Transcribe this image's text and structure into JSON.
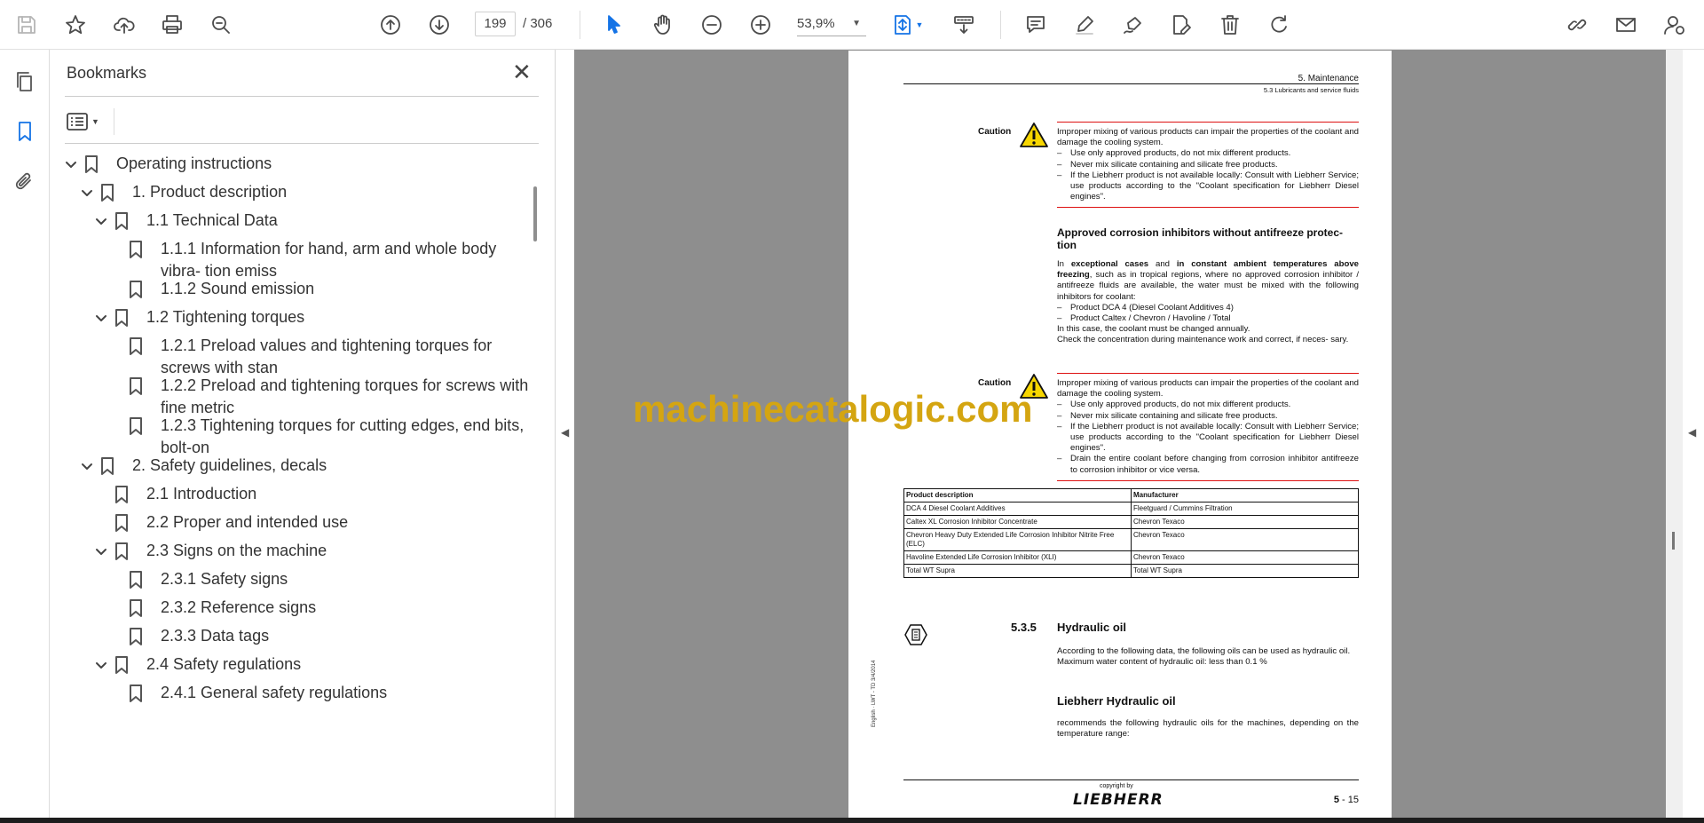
{
  "toolbar": {
    "page_current": "199",
    "page_total": "/ 306",
    "zoom": "53,9%",
    "accent_color": "#1473e6"
  },
  "panel": {
    "title": "Bookmarks",
    "close": "✕"
  },
  "bookmarks": [
    {
      "label": "Operating instructions",
      "level": 0,
      "expanded": true
    },
    {
      "label": "1. Product description",
      "level": 1,
      "expanded": true
    },
    {
      "label": "1.1 Technical Data",
      "level": 2,
      "expanded": true
    },
    {
      "label": "1.1.1 Information for hand, arm and whole body vibra- tion emiss",
      "level": 3
    },
    {
      "label": "1.1.2 Sound emission",
      "level": 3
    },
    {
      "label": "1.2 Tightening torques",
      "level": 2,
      "expanded": true
    },
    {
      "label": "1.2.1 Preload values and tightening torques for screws with stan",
      "level": 3
    },
    {
      "label": "1.2.2 Preload and tightening torques for screws with fine metric",
      "level": 3
    },
    {
      "label": "1.2.3 Tightening torques for cutting edges, end bits, bolt-on",
      "level": 3
    },
    {
      "label": "2. Safety guidelines, decals",
      "level": 1,
      "expanded": true
    },
    {
      "label": "2.1 Introduction",
      "level": 2
    },
    {
      "label": "2.2 Proper and intended use",
      "level": 2
    },
    {
      "label": "2.3 Signs on the machine",
      "level": 2,
      "expanded": true
    },
    {
      "label": "2.3.1 Safety signs",
      "level": 3
    },
    {
      "label": "2.3.2 Reference signs",
      "level": 3
    },
    {
      "label": "2.3.3 Data tags",
      "level": 3
    },
    {
      "label": "2.4 Safety regulations",
      "level": 2,
      "expanded": true
    },
    {
      "label": "2.4.1 General safety regulations",
      "level": 3
    }
  ],
  "doc": {
    "header_chapter": "5. Maintenance",
    "header_section": "5.3 Lubricants and service fluids",
    "caution_label": "Caution",
    "caution1_intro": "Improper mixing of various products can impair the properties of the coolant and damage the cooling system.",
    "caution1_items": [
      "Use only approved products, do not mix different products.",
      "Never mix silicate containing and silicate free products.",
      "If the Liebherr product is not available locally: Consult with Liebherr Service; use products according to the \"Coolant specification for Liebherr Diesel engines\"."
    ],
    "inhib_heading": "Approved corrosion inhibitors without antifreeze protec- tion",
    "inhib_p1_a": "In ",
    "inhib_p1_b": "exceptional cases",
    "inhib_p1_c": " and ",
    "inhib_p1_d": "in constant ambient temperatures above freezing",
    "inhib_p1_e": ", such as in tropical regions, where no approved corrosion inhibitor / antifreeze fluids are available, the water must be mixed with the following inhibitors for coolant:",
    "inhib_items": [
      "Product DCA 4 (Diesel Coolant Additives 4)",
      "Product Caltex / Chevron / Havoline / Total"
    ],
    "inhib_p2": "In this case, the coolant must be changed annually.",
    "inhib_p3": "Check the concentration during maintenance work and correct, if neces- sary.",
    "caution2_intro": "Improper mixing of various products can impair the properties of the coolant and damage the cooling system.",
    "caution2_items": [
      "Use only approved products, do not mix different products.",
      "Never mix silicate containing and silicate free products.",
      "If the Liebherr product is not available locally: Consult with Liebherr Service; use products according to the \"Coolant specification for Liebherr Diesel engines\".",
      "Drain the entire coolant before changing from corrosion inhibitor antifreeze to corrosion inhibitor or vice versa."
    ],
    "table_headers": [
      "Product description",
      "Manufacturer"
    ],
    "table_rows": [
      [
        "DCA 4 Diesel Coolant Additives",
        "Fleetguard / Cummins Filtration"
      ],
      [
        "Caltex XL Corrosion Inhibitor Concentrate",
        "Chevron Texaco"
      ],
      [
        "Chevron Heavy Duty Extended Life Corrosion Inhibitor Nitrite Free (ELC)",
        "Chevron Texaco"
      ],
      [
        "Havoline Extended Life Corrosion Inhibitor (XLI)",
        "Chevron Texaco"
      ],
      [
        "Total WT Supra",
        "Total WT Supra"
      ]
    ],
    "sec_num": "5.3.5",
    "sec_title": "Hydraulic oil",
    "hyd_p1": "According to the following data, the following oils can be used as hydraulic oil.",
    "hyd_p2": "Maximum water content of hydraulic oil: less than 0.1 %",
    "hyd_heading": "Liebherr Hydraulic oil",
    "hyd_p3": "recommends the following hydraulic oils for the machines, depending on the temperature range:",
    "side_text": "English · LWT - TD 3/4/2014",
    "footer_copyright": "copyright by",
    "footer_brand": "LIEBHERR",
    "footer_page_a": "5",
    "footer_page_b": " - 15"
  },
  "watermark": "machinecatalogic.com"
}
